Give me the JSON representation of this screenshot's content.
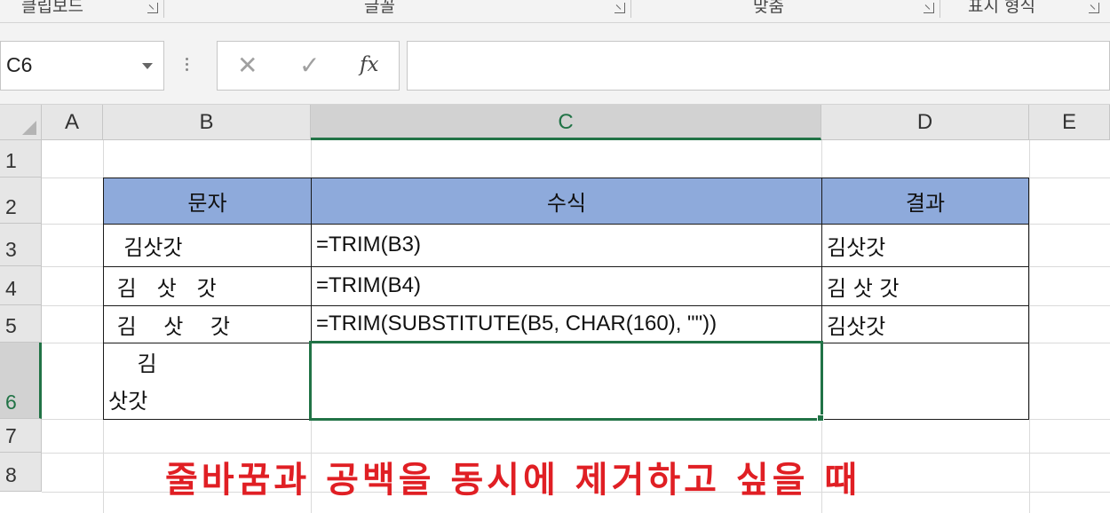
{
  "ribbon": {
    "groups": [
      "클립보드",
      "글꼴",
      "맞춤",
      "표시 형식"
    ]
  },
  "formula_bar": {
    "name_box": "C6",
    "cancel_icon": "✕",
    "enter_icon": "✓",
    "fx_label": "fx",
    "formula": ""
  },
  "sheet": {
    "columns": [
      "A",
      "B",
      "C",
      "D",
      "E"
    ],
    "rows": [
      "1",
      "2",
      "3",
      "4",
      "5",
      "6",
      "7",
      "8"
    ],
    "selected_cell": "C6",
    "table": {
      "headers": [
        "문자",
        "수식",
        "결과"
      ],
      "rows": [
        {
          "text": "  김삿갓",
          "formula": "=TRIM(B3)",
          "result": "김삿갓"
        },
        {
          "text": " 김   삿   갓",
          "formula": "=TRIM(B4)",
          "result": "김 삿 갓"
        },
        {
          "text": " 김    삿    갓",
          "formula": "=TRIM(SUBSTITUTE(B5, CHAR(160), \"\"))",
          "result": "김삿갓"
        },
        {
          "text_line1": "    김",
          "text_line2": "삿갓",
          "formula": "",
          "result": ""
        }
      ]
    },
    "caption": "줄바꿈과 공백을 동시에 제거하고 싶을 때"
  },
  "colors": {
    "header_fill": "#8eaadb",
    "selection": "#217346",
    "caption": "#e01f24"
  }
}
